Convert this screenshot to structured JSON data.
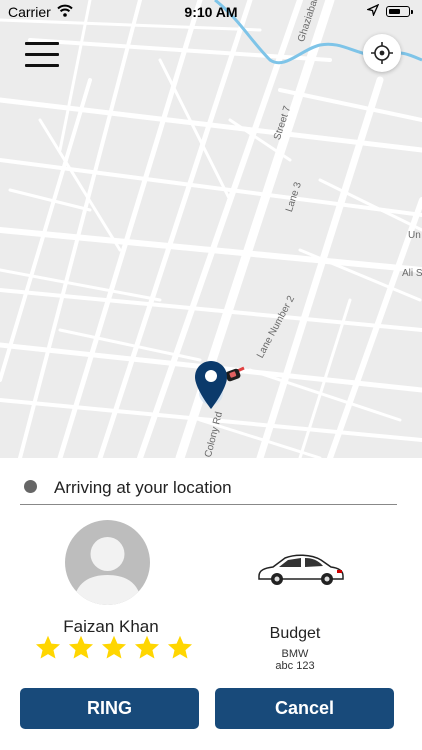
{
  "status_bar": {
    "carrier": "Carrier",
    "time": "9:10 AM",
    "icons": [
      "wifi-icon",
      "location-arrow-icon",
      "battery-icon"
    ]
  },
  "map": {
    "road_labels": {
      "ghaziabad_rd": "Ghaziabad Rd",
      "street_7": "Street 7",
      "lane_3": "Lane 3",
      "lane_number_2": "Lane Number 2",
      "colony_rd": "Colony Rd",
      "un": "Un",
      "ali_s": "Ali S"
    },
    "pin_color": "#0b3a6b",
    "river_color": "#7ec4e8"
  },
  "trip": {
    "status_text": "Arriving at your location",
    "driver": {
      "name": "Faizan Khan",
      "rating": 5,
      "rating_max": 5
    },
    "car": {
      "category": "Budget",
      "model": "BMW",
      "plate": "abc 123"
    }
  },
  "actions": {
    "ring_label": "RING",
    "cancel_label": "Cancel"
  },
  "colors": {
    "button_bg": "#184a7a",
    "star": "#ffd600"
  }
}
